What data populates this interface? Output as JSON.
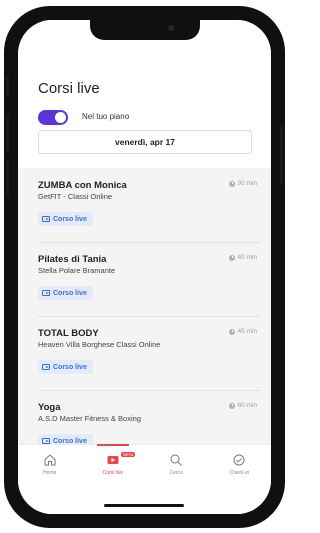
{
  "header": {
    "title": "Corsi live",
    "toggle_label": "Nel tuo piano",
    "toggle_on": true,
    "date": "venerdì, apr 17"
  },
  "courses": [
    {
      "title": "ZUMBA con Monica",
      "provider": "GetFIT - Classi Online",
      "duration": "30 min",
      "badge": "Corso live"
    },
    {
      "title": "Pilates di Tania",
      "provider": "Stella Polare Bramante",
      "duration": "40 min",
      "badge": "Corso live"
    },
    {
      "title": "TOTAL BODY",
      "provider": "Heaven Villa Borghese Classi Online",
      "duration": "45 min",
      "badge": "Corso live"
    },
    {
      "title": "Yoga",
      "provider": "A.S.D Master Fitness & Boxing",
      "duration": "60 min",
      "badge": "Corso live"
    }
  ],
  "tabbar": {
    "items": [
      {
        "label": "Home",
        "icon": "home-icon",
        "active": false
      },
      {
        "label": "Corsi live",
        "icon": "live-icon",
        "active": true,
        "badge": "BETA"
      },
      {
        "label": "Cerca",
        "icon": "search-icon",
        "active": false
      },
      {
        "label": "Check-in",
        "icon": "checkin-icon",
        "active": false
      }
    ]
  },
  "colors": {
    "accent_purple": "#5b35d6",
    "live_blue": "#3a6fd8",
    "active_red": "#e8474d"
  }
}
